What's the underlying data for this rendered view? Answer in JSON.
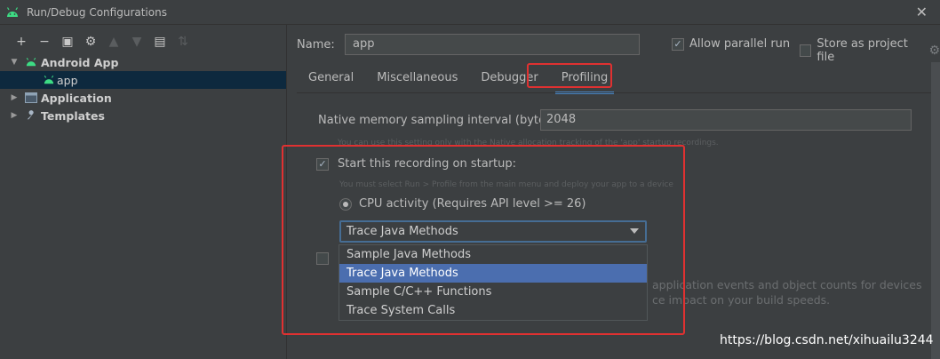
{
  "window": {
    "title": "Run/Debug Configurations",
    "close_glyph": "✕"
  },
  "toolbar": {
    "add": "+",
    "remove": "−",
    "copy": "▣",
    "settings": "⚙",
    "up": "▲",
    "down": "▼",
    "folder": "▤",
    "sort": "⇅"
  },
  "tree": {
    "items": [
      {
        "label": "Android App",
        "expanded": true,
        "arrow": "▼"
      },
      {
        "label": "app"
      },
      {
        "label": "Application",
        "arrow": "▶"
      },
      {
        "label": "Templates",
        "arrow": "▶"
      }
    ]
  },
  "config": {
    "name_label": "Name:",
    "name_value": "app",
    "allow_parallel_run": "Allow parallel run",
    "allow_parallel_run_checked": true,
    "store_as_project_file": "Store as project file"
  },
  "tabs": [
    "General",
    "Miscellaneous",
    "Debugger",
    "Profiling"
  ],
  "profiling": {
    "native_label": "Native memory sampling interval (bytes):",
    "native_value": "2048",
    "native_hint": "You can use this setting only with the Native allocation tracking of the 'app' startup recordings.",
    "start_label": "Start this recording on startup:",
    "start_checked": true,
    "start_hint": "You must select Run > Profile from the main menu and deploy your app to a device",
    "cpu_label": "CPU activity (Requires API level >= 26)",
    "select_value": "Trace Java Methods",
    "options": [
      "Sample Java Methods",
      "Trace Java Methods",
      "Sample C/C++ Functions",
      "Trace System Calls"
    ],
    "faded_line1": "application events and object counts for devices",
    "faded_line2": "ce impact on your build speeds."
  },
  "watermark": "https://blog.csdn.net/xihuailu3244",
  "colors": {
    "android_green": "#3ddc84",
    "highlight_red": "#e03131",
    "selection_blue": "#4b6eaf"
  }
}
